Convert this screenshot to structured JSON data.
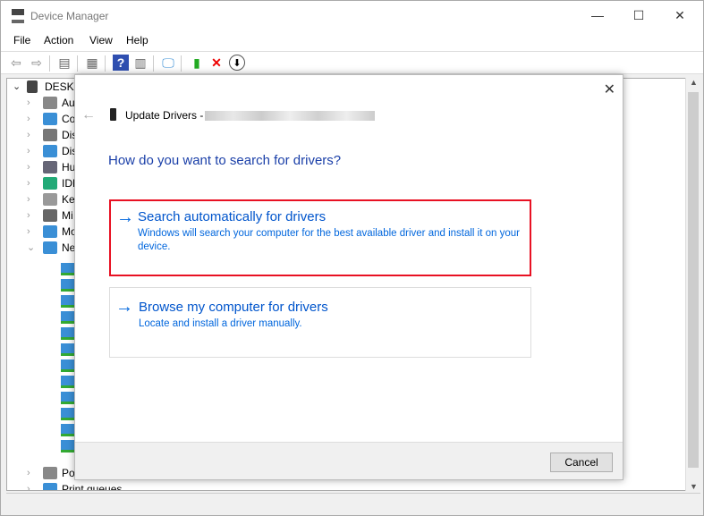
{
  "window": {
    "title": "Device Manager",
    "minimize": "—",
    "maximize": "☐",
    "close": "✕"
  },
  "menu": [
    "File",
    "Action",
    "View",
    "Help"
  ],
  "toolbar": [
    "back-icon",
    "forward-icon",
    "show-hide-console-tree-icon",
    "properties-icon",
    "help-icon",
    "action-pane-icon",
    "scan-hardware-icon",
    "update-driver-icon",
    "uninstall-icon",
    "disable-icon"
  ],
  "tree": {
    "root": "DESKT",
    "nodes": [
      "Au",
      "Co",
      "Dis",
      "Dis",
      "Hu",
      "IDE",
      "Ke",
      "Mi",
      "Mo",
      "Ne"
    ],
    "after": [
      "Po",
      "Print queues"
    ]
  },
  "dialog": {
    "title": "Update Drivers -",
    "close": "✕",
    "question": "How do you want to search for drivers?",
    "options": [
      {
        "title": "Search automatically for drivers",
        "desc": "Windows will search your computer for the best available driver and install it on your device.",
        "highlighted": true
      },
      {
        "title": "Browse my computer for drivers",
        "desc": "Locate and install a driver manually.",
        "highlighted": false
      }
    ],
    "cancel": "Cancel"
  },
  "colors": {
    "accent": "#0066dd",
    "highlight": "#e81123"
  }
}
